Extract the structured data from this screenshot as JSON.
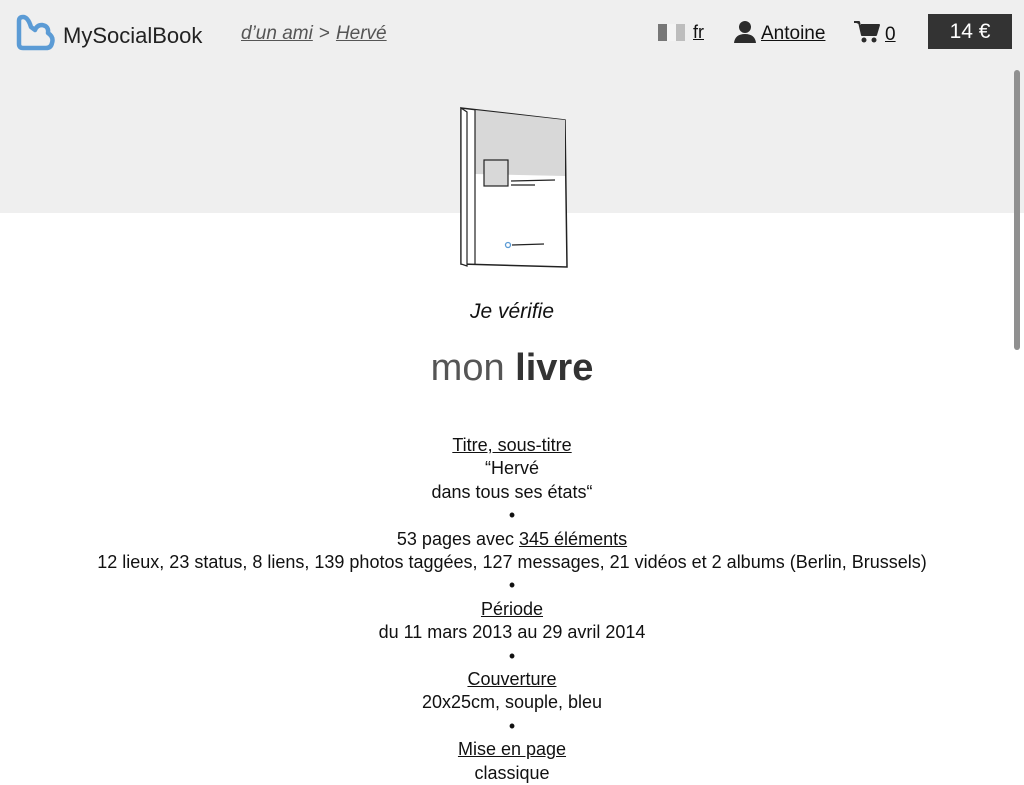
{
  "header": {
    "brand": "MySocialBook",
    "breadcrumb": [
      "d’un ami",
      "Hervé"
    ],
    "breadcrumb_separator": ">",
    "language": "fr",
    "user": "Antoine",
    "cart_count": "0",
    "price": "14 €"
  },
  "icons": {
    "logo": "heart-book-logo",
    "flag": "flag-icon",
    "user": "user-icon",
    "cart": "cart-icon"
  },
  "colors": {
    "logo_blue": "#5b9bd5",
    "band": "#efefef",
    "price_bg": "#333333"
  },
  "main": {
    "subtitle": "Je vérifie",
    "title_light": "mon",
    "title_bold": "livre",
    "sections": {
      "title_label": "Titre, sous-titre",
      "title_value_line1": "“Hervé",
      "title_value_line2": "dans tous ses états“",
      "bullet": "•",
      "pages_prefix": "53 pages avec",
      "elements_link": "345 éléments",
      "elements_detail": "12 lieux, 23 status, 8 liens, 139 photos taggées, 127 messages, 21 vidéos et 2 albums (Berlin, Brussels)",
      "period_label": "Période",
      "period_value": "du 11 mars 2013 au 29 avril 2014",
      "cover_label": "Couverture",
      "cover_value": "20x25cm, souple, bleu",
      "layout_label": "Mise en page",
      "layout_value": "classique"
    }
  }
}
